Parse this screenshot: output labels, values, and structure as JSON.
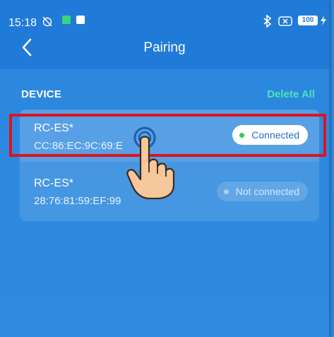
{
  "status_bar": {
    "time": "15:18",
    "battery": "100"
  },
  "header": {
    "title": "Pairing"
  },
  "section": {
    "label": "DEVICE",
    "delete_all": "Delete All"
  },
  "devices": [
    {
      "name": "RC-ES*",
      "mac": "CC:86:EC:9C:69:E",
      "status": "Connected",
      "status_color": "#34c759"
    },
    {
      "name": "RC-ES*",
      "mac": "28:76:81:59:EF:99",
      "status": "Not connected",
      "status_color": "#b7cde6"
    }
  ],
  "colors": {
    "header_bg": "#1f7ad8",
    "page_bg": "#2f8be0",
    "accent": "#4de3b2",
    "annotation": "#e0121a"
  }
}
